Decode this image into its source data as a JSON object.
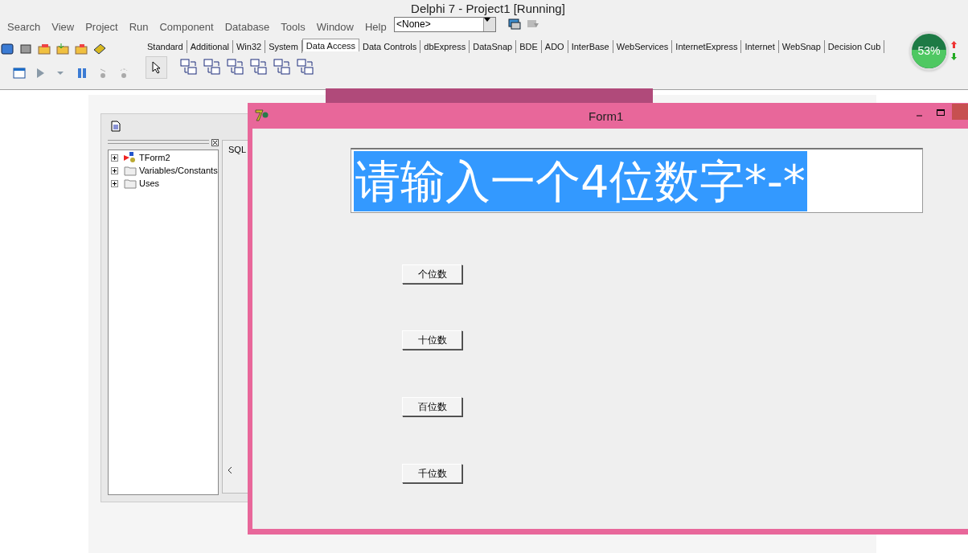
{
  "ide": {
    "title": "Delphi 7 - Project1 [Running]",
    "menu": [
      "Search",
      "View",
      "Project",
      "Run",
      "Component",
      "Database",
      "Tools",
      "Window",
      "Help"
    ],
    "combo": {
      "value": "<None>"
    },
    "palette_tabs": [
      {
        "label": "Standard",
        "selected": false
      },
      {
        "label": "Additional",
        "selected": false
      },
      {
        "label": "Win32",
        "selected": false
      },
      {
        "label": "System",
        "selected": false
      },
      {
        "label": "Data Access",
        "selected": true
      },
      {
        "label": "Data Controls",
        "selected": false
      },
      {
        "label": "dbExpress",
        "selected": false
      },
      {
        "label": "DataSnap",
        "selected": false
      },
      {
        "label": "BDE",
        "selected": false
      },
      {
        "label": "ADO",
        "selected": false
      },
      {
        "label": "InterBase",
        "selected": false
      },
      {
        "label": "WebServices",
        "selected": false
      },
      {
        "label": "InternetExpress",
        "selected": false
      },
      {
        "label": "Internet",
        "selected": false
      },
      {
        "label": "WebSnap",
        "selected": false
      },
      {
        "label": "Decision Cub"
      }
    ]
  },
  "meter": {
    "reading": "53%"
  },
  "explorer": {
    "tree": [
      {
        "label": "TForm2",
        "kind": "form",
        "expanded": false
      },
      {
        "label": "Variables/Constants",
        "kind": "folder",
        "expanded": false
      },
      {
        "label": "Uses",
        "kind": "folder",
        "expanded": false
      }
    ],
    "tab": "SQL"
  },
  "form": {
    "title": "Form1",
    "edit": {
      "value": "请输入一个4位数字*-*",
      "selected": true
    },
    "buttons": [
      "个位数",
      "十位数",
      "百位数",
      "千位数"
    ]
  }
}
